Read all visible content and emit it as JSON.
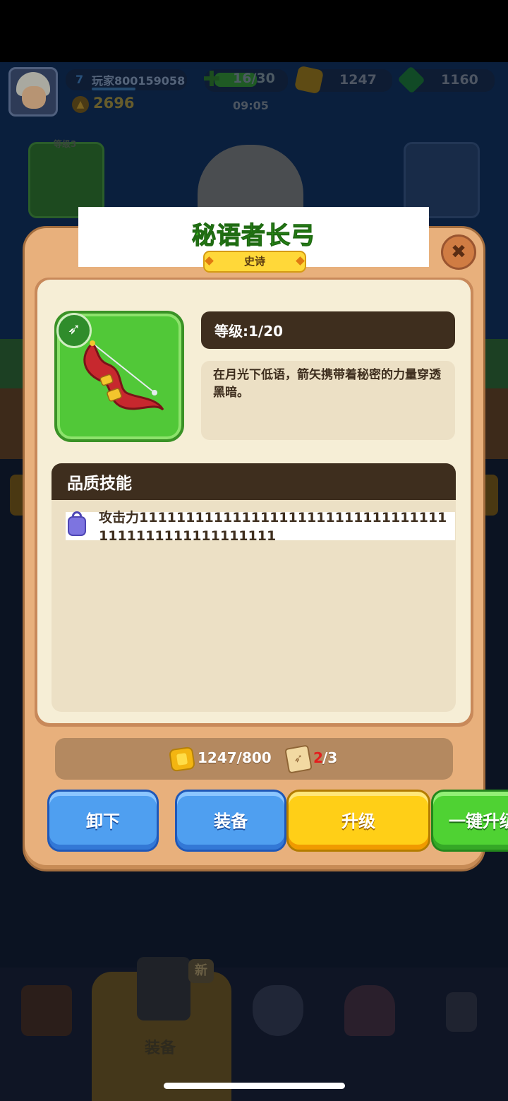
{
  "player": {
    "level": "7",
    "name": "玩家800159058",
    "power": "2696"
  },
  "resources": {
    "energy": "16/30",
    "energy_timer": "09:05",
    "gold": "1247",
    "gems": "1160"
  },
  "equipped_slot": {
    "level_label": "等级3"
  },
  "dialog": {
    "title": "秘语者长弓",
    "rarity": "史诗",
    "level": "等级:1/20",
    "description": "在月光下低语，箭矢携带着秘密的力量穿透黑暗。",
    "skill_header": "品质技能",
    "skills": [
      {
        "text": "攻击力1111111111111111111111111111111111111111111111111111",
        "locked": true
      }
    ],
    "cost": {
      "gold": "1247/800",
      "scroll_current": "2",
      "scroll_total": "/3"
    },
    "buttons": {
      "unequip": "卸下",
      "equip": "装备",
      "upgrade": "升级",
      "one_click_upgrade": "一键升级"
    }
  },
  "bottom_nav": {
    "active_label": "装备",
    "new_badge": "新"
  },
  "colors": {
    "title_green": "#37b71c",
    "epic_yellow": "#ffd839",
    "button_blue": "#4f9ff0",
    "button_yellow": "#ffcf17",
    "button_green": "#4fd233",
    "panel_cream": "#f6eed6",
    "panel_tan": "#e8b07c",
    "dark_header": "#3e2e1e"
  }
}
